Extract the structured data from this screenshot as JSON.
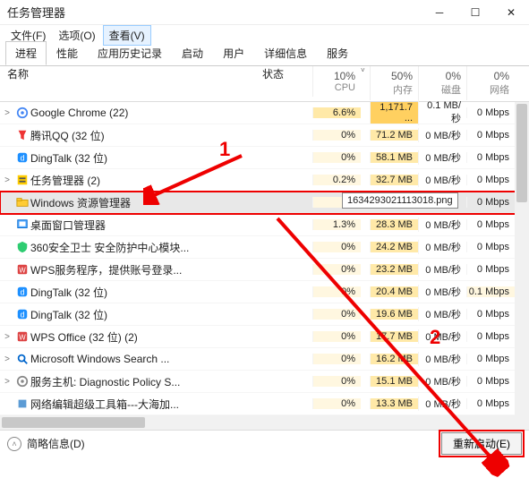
{
  "window": {
    "title": "任务管理器"
  },
  "menu": {
    "file": "文件(F)",
    "options": "选项(O)",
    "view": "查看(V)"
  },
  "tabs": [
    "进程",
    "性能",
    "应用历史记录",
    "启动",
    "用户",
    "详细信息",
    "服务"
  ],
  "columns": {
    "name": "名称",
    "status": "状态",
    "cpu": {
      "pct": "10%",
      "label": "CPU"
    },
    "mem": {
      "pct": "50%",
      "label": "内存"
    },
    "disk": {
      "pct": "0%",
      "label": "磁盘"
    },
    "net": {
      "pct": "0%",
      "label": "网络"
    }
  },
  "rows": [
    {
      "exp": ">",
      "name": "Google Chrome (22)",
      "cpu": "6.6%",
      "mem": "1,171.7 ...",
      "disk": "0.1 MB/秒",
      "net": "0 Mbps",
      "cpuH": "med",
      "memH": "hi"
    },
    {
      "exp": "",
      "name": "腾讯QQ (32 位)",
      "cpu": "0%",
      "mem": "71.2 MB",
      "disk": "0 MB/秒",
      "net": "0 Mbps",
      "cpuH": "low",
      "memH": "med"
    },
    {
      "exp": "",
      "name": "DingTalk (32 位)",
      "cpu": "0%",
      "mem": "58.1 MB",
      "disk": "0 MB/秒",
      "net": "0 Mbps",
      "cpuH": "low",
      "memH": "med"
    },
    {
      "exp": ">",
      "name": "任务管理器 (2)",
      "cpu": "0.2%",
      "mem": "32.7 MB",
      "disk": "0 MB/秒",
      "net": "0 Mbps",
      "cpuH": "low",
      "memH": "med"
    },
    {
      "exp": "",
      "name": "Windows 资源管理器",
      "cpu": "0...",
      "mem": "",
      "disk": "",
      "net": "0 Mbps",
      "cpuH": "low",
      "memH": "med",
      "selected": true,
      "boxed": true
    },
    {
      "exp": "",
      "name": "桌面窗口管理器",
      "cpu": "1.3%",
      "mem": "28.3 MB",
      "disk": "0 MB/秒",
      "net": "0 Mbps",
      "cpuH": "low",
      "memH": "med"
    },
    {
      "exp": "",
      "name": "360安全卫士 安全防护中心模块...",
      "cpu": "0%",
      "mem": "24.2 MB",
      "disk": "0 MB/秒",
      "net": "0 Mbps",
      "cpuH": "low",
      "memH": "med"
    },
    {
      "exp": "",
      "name": "WPS服务程序，提供账号登录...",
      "cpu": "0%",
      "mem": "23.2 MB",
      "disk": "0 MB/秒",
      "net": "0 Mbps",
      "cpuH": "low",
      "memH": "med"
    },
    {
      "exp": "",
      "name": "DingTalk (32 位)",
      "cpu": "0%",
      "mem": "20.4 MB",
      "disk": "0 MB/秒",
      "net": "0.1 Mbps",
      "cpuH": "low",
      "memH": "med",
      "netH": "low"
    },
    {
      "exp": "",
      "name": "DingTalk (32 位)",
      "cpu": "0%",
      "mem": "19.6 MB",
      "disk": "0 MB/秒",
      "net": "0 Mbps",
      "cpuH": "low",
      "memH": "med"
    },
    {
      "exp": ">",
      "name": "WPS Office (32 位) (2)",
      "cpu": "0%",
      "mem": "17.7 MB",
      "disk": "0 MB/秒",
      "net": "0 Mbps",
      "cpuH": "low",
      "memH": "med"
    },
    {
      "exp": ">",
      "name": "Microsoft Windows Search ...",
      "cpu": "0%",
      "mem": "16.2 MB",
      "disk": "0 MB/秒",
      "net": "0 Mbps",
      "cpuH": "low",
      "memH": "med"
    },
    {
      "exp": ">",
      "name": "服务主机: Diagnostic Policy S...",
      "cpu": "0%",
      "mem": "15.1 MB",
      "disk": "0 MB/秒",
      "net": "0 Mbps",
      "cpuH": "low",
      "memH": "med"
    },
    {
      "exp": "",
      "name": "网络编辑超级工具箱---大海加...",
      "cpu": "0%",
      "mem": "13.3 MB",
      "disk": "0 MB/秒",
      "net": "0 Mbps",
      "cpuH": "low",
      "memH": "med"
    }
  ],
  "tooltip": "1634293021113018.png",
  "footer": {
    "less": "简略信息(D)",
    "restart": "重新启动(E)"
  },
  "annotations": {
    "one": "1",
    "two": "2"
  }
}
